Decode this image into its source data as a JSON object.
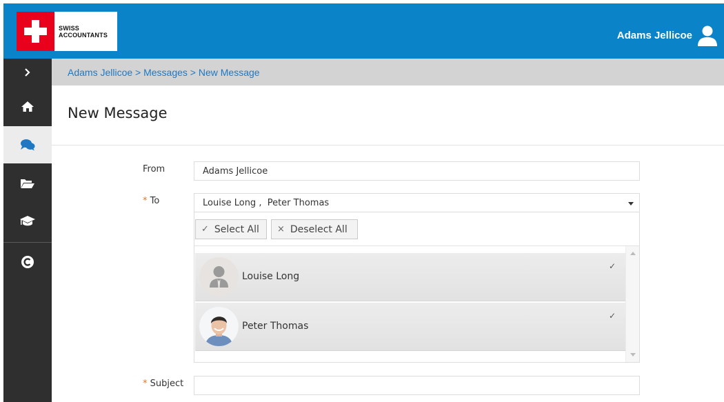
{
  "header": {
    "logo_line1": "SWISS",
    "logo_line2": "ACCOUNTANTS",
    "user_name": "Adams Jellicoe",
    "brand_color": "#0b83c9"
  },
  "sidebar": {
    "items": [
      {
        "icon": "chevron-right-icon"
      },
      {
        "icon": "home-icon"
      },
      {
        "icon": "chat-icon",
        "active": true
      },
      {
        "icon": "folder-open-icon"
      },
      {
        "icon": "graduation-cap-icon"
      },
      {
        "icon": "circular-c-icon"
      }
    ]
  },
  "breadcrumb": "Adams Jellicoe > Messages > New Message",
  "page": {
    "title": "New Message"
  },
  "form": {
    "from_label": "From",
    "from_value": "Adams Jellicoe",
    "required_mark": "*",
    "to_label": "To",
    "to_value": "Louise Long ,  Peter Thomas",
    "subject_label": "Subject",
    "subject_value": ""
  },
  "recipients_dropdown": {
    "select_all_glyph": "✓",
    "select_all_label": "Select All",
    "deselect_all_glyph": "×",
    "deselect_all_label": "Deselect All",
    "items": [
      {
        "name": "Louise Long",
        "check": "✓",
        "avatar": "placeholder-avatar"
      },
      {
        "name": "Peter Thomas",
        "check": "✓",
        "avatar": "photo-avatar"
      }
    ]
  }
}
